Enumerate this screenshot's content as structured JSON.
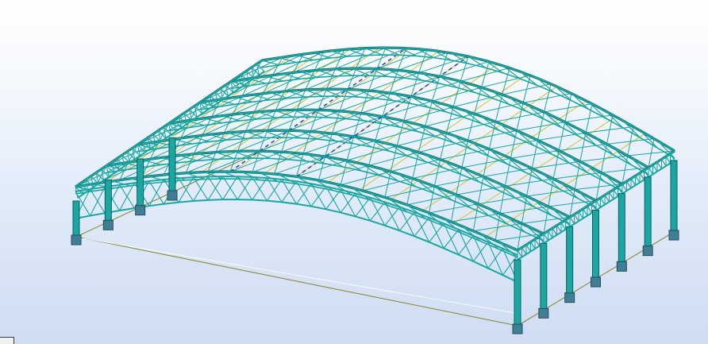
{
  "viewport": {
    "view": "3D",
    "background_top": "#ffffff",
    "background_bottom": "#cfdcf2"
  },
  "model": {
    "type": "steel-hangar-frame",
    "roof_shape": "arched",
    "frame_bays": 6,
    "member_color": "#1aa7a1",
    "member_edge_color": "#0d5f60",
    "support_color": "#3f7f95",
    "foundation_line_color": "#8b8a3a",
    "bracing_color": "#d8c850",
    "load_line_color": "#1f3fe0"
  },
  "icons": {
    "corner": "view-corner-icon"
  }
}
